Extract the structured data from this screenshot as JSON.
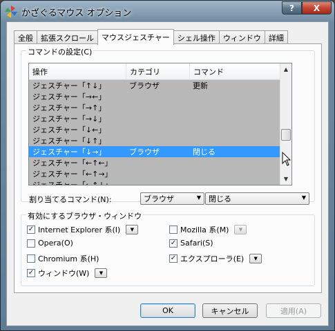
{
  "window": {
    "title": "かざぐるマウス オプション",
    "help_label": "?",
    "close_label": "X"
  },
  "tabs": [
    "全般",
    "拡張スクロール",
    "マウスジェスチャー",
    "シェル操作",
    "ウィンドウ",
    "詳細"
  ],
  "command_group": {
    "label": "コマンドの設定(C)",
    "columns": [
      "操作",
      "カテゴリ",
      "コマンド"
    ],
    "rows": [
      [
        "ジェスチャー「↑↓」",
        "ブラウザ",
        "更新"
      ],
      [
        "ジェスチャー「→←」",
        "",
        ""
      ],
      [
        "ジェスチャー「→↑」",
        "",
        ""
      ],
      [
        "ジェスチャー「→↓」",
        "",
        ""
      ],
      [
        "ジェスチャー「↓←」",
        "",
        ""
      ],
      [
        "ジェスチャー「↓↑」",
        "",
        ""
      ],
      [
        "ジェスチャー「↓→」",
        "ブラウザ",
        "閉じる"
      ],
      [
        "ジェスチャー「←↑←」",
        "",
        ""
      ],
      [
        "ジェスチャー「←↑→」",
        "",
        ""
      ],
      [
        "ジェスチャー「←↑↓」",
        "",
        ""
      ]
    ],
    "selected_index": 6,
    "assign_label": "割り当てるコマンド(N):",
    "category_value": "ブラウザ",
    "command_value": "閉じる"
  },
  "browser_group": {
    "label": "有効にするブラウザ・ウィンドウ",
    "items": [
      {
        "label": "Internet Explorer 系(I)",
        "checked": true,
        "button": true
      },
      {
        "label": "Mozilla 系(M)",
        "checked": false,
        "button": true
      },
      {
        "label": "Opera(O)",
        "checked": false,
        "button": false
      },
      {
        "label": "Safari(S)",
        "checked": true,
        "button": false
      },
      {
        "label": "Chromium 系(H)",
        "checked": false,
        "button": false
      },
      {
        "label": "エクスプローラ(E)",
        "checked": true,
        "button": true
      },
      {
        "label": "ウィンドウ(W)",
        "checked": true,
        "button": true
      }
    ]
  },
  "footer": {
    "ok": "OK",
    "cancel": "キャンセル",
    "apply": "適用(A)"
  },
  "icons": {
    "dropdown": "▼",
    "scroll_up": "▲",
    "scroll_down": "▼",
    "check": "✓"
  }
}
